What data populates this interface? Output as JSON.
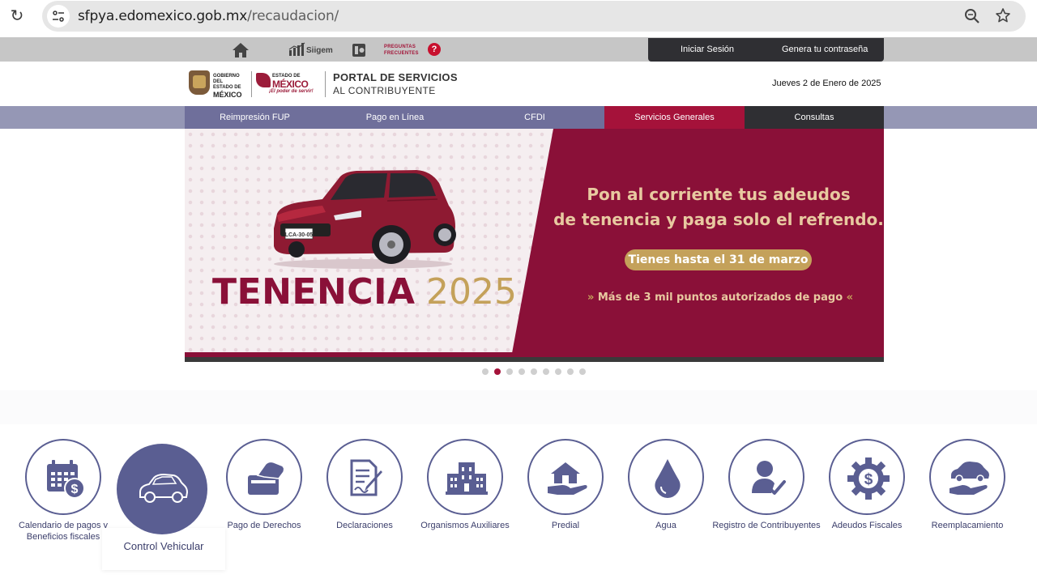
{
  "browser": {
    "url_domain": "sfpya.edomexico.gob.mx",
    "url_path": "/recaudacion/"
  },
  "utility": {
    "siigem_label": "Siigem",
    "faq_line1": "PREGUNTAS",
    "faq_line2": "FRECUENTES",
    "faq_mark": "?",
    "login": "Iniciar Sesión",
    "password": "Genera tu contraseña"
  },
  "header": {
    "gob_line1": "GOBIERNO DEL",
    "gob_line2": "ESTADO DE",
    "gob_line3": "MÉXICO",
    "edo_line1": "ESTADO DE",
    "edo_line2": "MÉXICO",
    "edo_slogan": "¡El poder de servir!",
    "portal_title": "PORTAL DE SERVICIOS",
    "portal_subtitle": "AL CONTRIBUYENTE",
    "date": "Jueves 2 de Enero de 2025"
  },
  "nav": {
    "items": [
      {
        "label": "Reimpresión FUP"
      },
      {
        "label": "Pago en Línea"
      },
      {
        "label": "CFDI"
      },
      {
        "label": "Servicios Generales"
      },
      {
        "label": "Consultas"
      }
    ]
  },
  "banner": {
    "plate": "LCA-30-05",
    "title_word": "TENENCIA",
    "title_year": "2025",
    "promo_line1": "Pon al corriente tus adeudos",
    "promo_line2": "de tenencia y paga solo el refrendo.",
    "deadline": "Tienes hasta el 31 de marzo",
    "points": "Más de 3 mil puntos autorizados de pago",
    "colors": {
      "maroon": "#8a1038",
      "gold": "#c4a15a",
      "cream": "#e8c9a0"
    }
  },
  "carousel": {
    "total": 9,
    "active_index": 1
  },
  "services": [
    {
      "label": "Calendario de pagos y Beneficios fiscales",
      "icon": "calendar-dollar-icon"
    },
    {
      "label": "Control Vehicular",
      "icon": "car-icon",
      "active": true
    },
    {
      "label": "Pago de Derechos",
      "icon": "card-payment-icon"
    },
    {
      "label": "Declaraciones",
      "icon": "document-sign-icon"
    },
    {
      "label": "Organismos Auxiliares",
      "icon": "building-icon"
    },
    {
      "label": "Predial",
      "icon": "house-hand-icon"
    },
    {
      "label": "Agua",
      "icon": "water-drop-icon"
    },
    {
      "label": "Registro de Contribuyentes",
      "icon": "user-check-icon"
    },
    {
      "label": "Adeudos Fiscales",
      "icon": "gear-dollar-icon"
    },
    {
      "label": "Reemplacamiento",
      "icon": "car-hand-icon"
    }
  ],
  "theme": {
    "purple": "#5a5e92",
    "nav_bg": "#6f6f9b",
    "active_red": "#a5123a",
    "dark": "#2f2f33"
  }
}
